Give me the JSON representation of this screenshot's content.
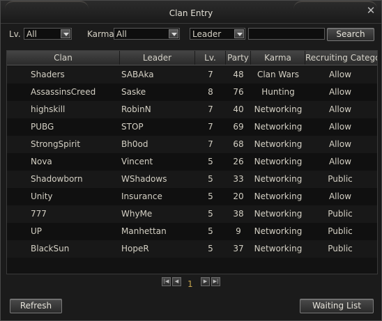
{
  "window": {
    "title": "Clan Entry",
    "close_symbol": "✕"
  },
  "filters": {
    "lv_label": "Lv.",
    "lv_value": "All",
    "karma_label": "Karma",
    "karma_value": "All",
    "search_type_value": "Leader",
    "search_text": "",
    "search_button": "Search"
  },
  "table": {
    "columns": [
      "Clan",
      "Leader",
      "Lv.",
      "Party",
      "Karma",
      "Recruiting Category"
    ],
    "rows": [
      {
        "clan": "Shaders",
        "leader": "SABAka",
        "lv": "7",
        "party": "48",
        "karma": "Clan Wars",
        "recruiting": "Allow"
      },
      {
        "clan": "AssassinsCreed",
        "leader": "Saske",
        "lv": "8",
        "party": "76",
        "karma": "Hunting",
        "recruiting": "Allow"
      },
      {
        "clan": "highskill",
        "leader": "RobinN",
        "lv": "7",
        "party": "40",
        "karma": "Networking",
        "recruiting": "Allow"
      },
      {
        "clan": "PUBG",
        "leader": "STOP",
        "lv": "7",
        "party": "69",
        "karma": "Networking",
        "recruiting": "Allow"
      },
      {
        "clan": "StrongSpirit",
        "leader": "Bh0od",
        "lv": "7",
        "party": "68",
        "karma": "Networking",
        "recruiting": "Allow"
      },
      {
        "clan": "Nova",
        "leader": "Vincent",
        "lv": "5",
        "party": "26",
        "karma": "Networking",
        "recruiting": "Allow"
      },
      {
        "clan": "Shadowborn",
        "leader": "WShadows",
        "lv": "5",
        "party": "33",
        "karma": "Networking",
        "recruiting": "Public"
      },
      {
        "clan": "Unity",
        "leader": "Insurance",
        "lv": "5",
        "party": "20",
        "karma": "Networking",
        "recruiting": "Allow"
      },
      {
        "clan": "777",
        "leader": "WhyMe",
        "lv": "5",
        "party": "38",
        "karma": "Networking",
        "recruiting": "Public"
      },
      {
        "clan": "UP",
        "leader": "Manhettan",
        "lv": "5",
        "party": "9",
        "karma": "Networking",
        "recruiting": "Public"
      },
      {
        "clan": "BlackSun",
        "leader": "HopeR",
        "lv": "5",
        "party": "37",
        "karma": "Networking",
        "recruiting": "Public"
      }
    ]
  },
  "pagination": {
    "current_page": "1"
  },
  "footer": {
    "refresh_button": "Refresh",
    "waiting_list_button": "Waiting List"
  },
  "icons": {
    "first_page": "first-page-icon",
    "prev_page": "prev-page-icon",
    "next_page": "next-page-icon",
    "last_page": "last-page-icon",
    "dropdown": "chevron-down-icon",
    "close": "close-icon"
  }
}
